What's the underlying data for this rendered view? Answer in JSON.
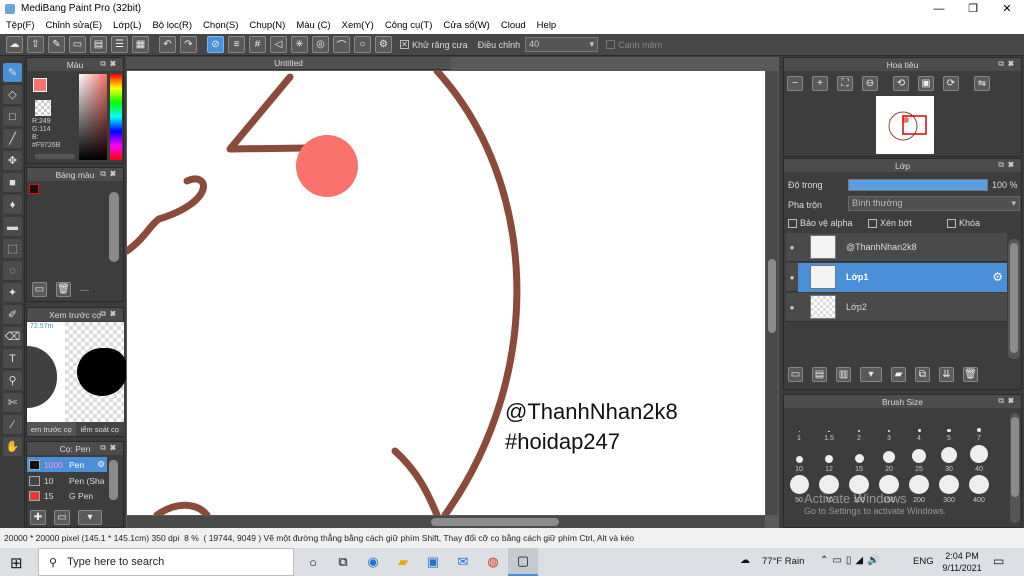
{
  "window": {
    "title": "MediBang Paint Pro (32bit)",
    "minimize": "—",
    "maximize": "❐",
    "close": "✕"
  },
  "menu": [
    "Tệp(F)",
    "Chỉnh sửa(E)",
    "Lớp(L)",
    "Bộ lọc(R)",
    "Chọn(S)",
    "Chụp(N)",
    "Màu (C)",
    "Xem(Y)",
    "Công cụ(T)",
    "Cửa sổ(W)",
    "Cloud",
    "Help"
  ],
  "toolbar": {
    "antialias_label": "Khử răng cưa",
    "correction_label": "Điều chỉnh",
    "correction_value": "40",
    "edge_label": "Canh mềm"
  },
  "color_panel": {
    "title": "Màu",
    "r": "R:249",
    "g": "G:114",
    "b": "B:",
    "hex": "#F9726B",
    "primary": "#F9726B"
  },
  "palette_panel": {
    "title": "Bảng màu",
    "footer": "---"
  },
  "preview_panel": {
    "title": "Xem trước cọ",
    "zoom": "72.57m",
    "tab1": "em trước cọ",
    "tab2": "iểm soát cọ"
  },
  "brush_panel": {
    "title": "Cọ: Pen",
    "items": [
      {
        "size": "1000",
        "name": "Pen",
        "color": "#111111"
      },
      {
        "size": "10",
        "name": "Pen (Sha",
        "color": "#444444"
      },
      {
        "size": "15",
        "name": "G Pen",
        "color": "#e43a3a"
      }
    ]
  },
  "canvas": {
    "tab": "Untitled",
    "text_line1": "@ThanhNhan2k8",
    "text_line2": "#hoidap247",
    "stroke_color": "#8b4a3a",
    "dot_color": "#F9726B"
  },
  "navigator": {
    "title": "Hoa tiêu"
  },
  "layer_panel": {
    "title": "Lớp",
    "opacity_label": "Độ trong",
    "opacity_value": "100 %",
    "opacity": 1.0,
    "blend_label": "Pha trộn",
    "blend_value": "Bình thường",
    "protect_alpha": "Bảo vệ alpha",
    "clip": "Xén bớt",
    "lock": "Khóa",
    "layers": [
      {
        "name": "@ThanhNhan2k8",
        "selected": false
      },
      {
        "name": "Lớp1",
        "selected": true
      },
      {
        "name": "Lớp2",
        "selected": false
      }
    ]
  },
  "brush_size": {
    "title": "Brush Size",
    "sizes": [
      "1",
      "1.5",
      "2",
      "3",
      "4",
      "5",
      "7",
      "10",
      "12",
      "15",
      "20",
      "25",
      "30",
      "40",
      "50",
      "70",
      "100",
      "150",
      "200",
      "300",
      "400"
    ]
  },
  "watermark": {
    "line1": "Activate Windows",
    "line2": "Go to Settings to activate Windows."
  },
  "status": {
    "size": "20000 * 20000 pixel",
    "dims": "(145.1 * 145.1cm)",
    "dpi": "350 dpi",
    "zoom": "8 %",
    "coords": "( 19744, 9049 )",
    "hint": "Vẽ một đường thẳng bằng cách giữ phím Shift, Thay đổi cỡ cọ bằng cách giữ phím Ctrl, Alt và kéo"
  },
  "taskbar": {
    "search_placeholder": "Type here to search",
    "weather": "77°F  Rain",
    "lang": "ENG",
    "time": "2:04 PM",
    "date": "9/11/2021"
  }
}
